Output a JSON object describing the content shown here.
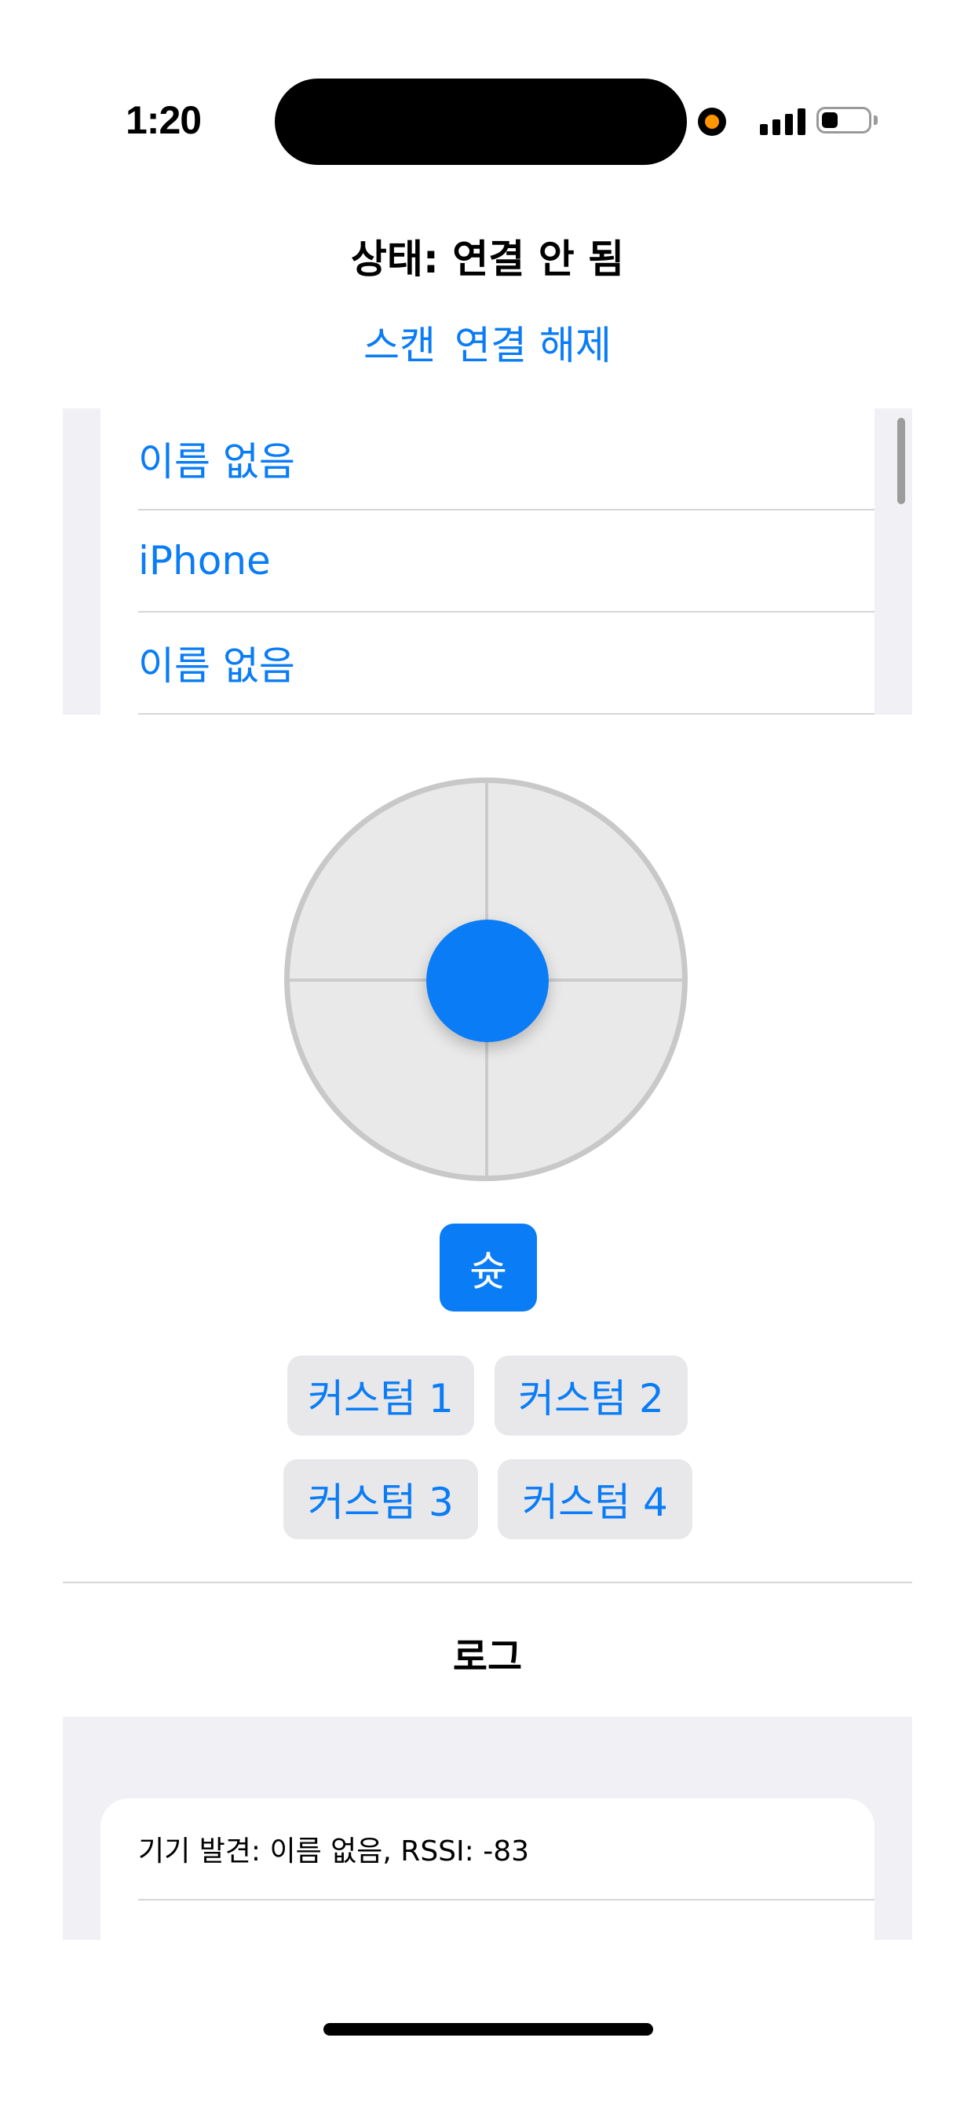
{
  "status_bar": {
    "time": "1:20"
  },
  "header": {
    "status_text": "상태: 연결 안 됨",
    "scan_label": "스캔",
    "disconnect_label": "연결 해제"
  },
  "devices": [
    {
      "name": "이름 없음"
    },
    {
      "name": "iPhone"
    },
    {
      "name": "이름 없음"
    }
  ],
  "controls": {
    "shoot_label": "슛",
    "custom_buttons": [
      "커스텀 1",
      "커스텀 2",
      "커스텀 3",
      "커스텀 4"
    ]
  },
  "log": {
    "title": "로그",
    "entries": [
      "기기 발견: 이름 없음, RSSI: -83"
    ]
  },
  "colors": {
    "accent": "#0a7cf5",
    "recording_dot": "#ff9500"
  }
}
